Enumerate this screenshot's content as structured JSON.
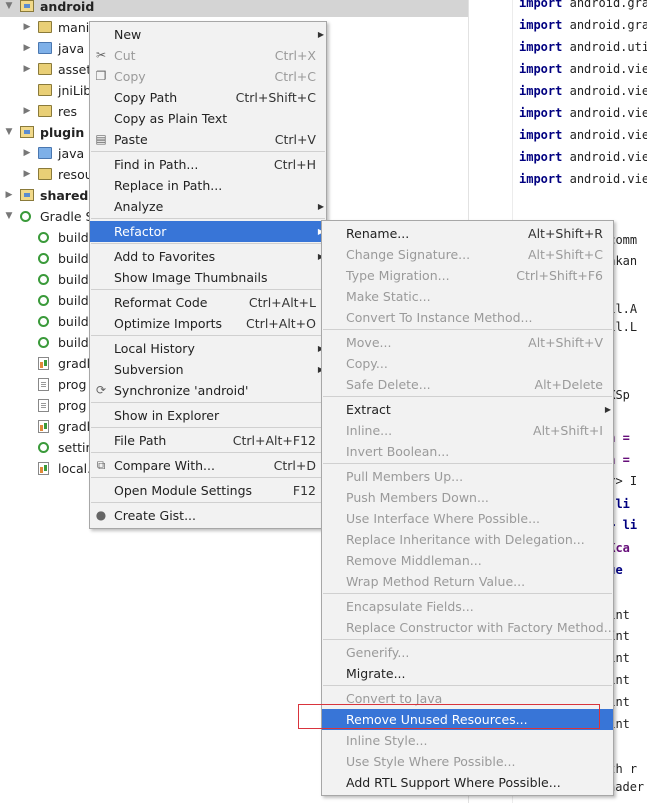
{
  "tree": {
    "items": [
      {
        "label": "android",
        "bold": true,
        "selected": true,
        "expanded": true,
        "depth": 0,
        "icon": "module-folder-icon"
      },
      {
        "label": "manit",
        "depth": 1,
        "icon": "folder-icon"
      },
      {
        "label": "java",
        "depth": 1,
        "icon": "source-folder-icon"
      },
      {
        "label": "asset",
        "depth": 1,
        "icon": "assets-folder-icon"
      },
      {
        "label": "jniLib",
        "depth": 1,
        "icon": "folder-icon",
        "noarrow": true
      },
      {
        "label": "res",
        "depth": 1,
        "icon": "resources-folder-icon"
      },
      {
        "label": "plugin",
        "bold": true,
        "expanded": true,
        "depth": 0,
        "icon": "module-folder-icon"
      },
      {
        "label": "java",
        "depth": 1,
        "icon": "source-folder-icon"
      },
      {
        "label": "resou",
        "depth": 1,
        "icon": "resources-folder-icon"
      },
      {
        "label": "shared",
        "bold": true,
        "depth": 0,
        "icon": "module-folder-icon"
      },
      {
        "label": "Gradle S",
        "expanded": true,
        "depth": 0,
        "icon": "gradle-icon"
      },
      {
        "label": "build",
        "depth": 1,
        "icon": "gradle-icon",
        "noarrow": true
      },
      {
        "label": "build",
        "depth": 1,
        "icon": "gradle-icon",
        "noarrow": true
      },
      {
        "label": "build",
        "depth": 1,
        "icon": "gradle-icon",
        "noarrow": true
      },
      {
        "label": "build",
        "depth": 1,
        "icon": "gradle-icon",
        "noarrow": true
      },
      {
        "label": "build",
        "depth": 1,
        "icon": "gradle-icon",
        "noarrow": true
      },
      {
        "label": "build",
        "depth": 1,
        "icon": "gradle-icon",
        "noarrow": true
      },
      {
        "label": "gradl",
        "depth": 1,
        "icon": "gradle-file-icon",
        "noarrow": true
      },
      {
        "label": "prog",
        "depth": 1,
        "icon": "text-file-icon",
        "noarrow": true
      },
      {
        "label": "prog",
        "depth": 1,
        "icon": "text-file-icon",
        "noarrow": true
      },
      {
        "label": "gradl",
        "depth": 1,
        "icon": "gradle-file-icon",
        "noarrow": true
      },
      {
        "label": "settin",
        "depth": 1,
        "icon": "gradle-icon",
        "noarrow": true
      },
      {
        "label": "local.",
        "depth": 1,
        "icon": "gradle-file-icon",
        "noarrow": true
      }
    ]
  },
  "editor": {
    "import_lines": [
      {
        "kw": "import",
        "text": "android.gra"
      },
      {
        "kw": "import",
        "text": "android.gra"
      },
      {
        "kw": "import",
        "text": "android.uti"
      },
      {
        "kw": "import",
        "text": "android.vie"
      },
      {
        "kw": "import",
        "text": "android.vie"
      },
      {
        "kw": "import",
        "text": "android.vie"
      },
      {
        "kw": "import",
        "text": "android.vie"
      },
      {
        "kw": "import",
        "text": "android.vie"
      },
      {
        "kw": "import",
        "text": "android.vie"
      }
    ],
    "fragments": [
      {
        "text": ".comm",
        "style": "plain"
      },
      {
        "text": "inkan",
        "style": "plain"
      },
      {
        "text": "til.A",
        "style": "plain"
      },
      {
        "text": "til.L",
        "style": "plain"
      },
      {
        "text": "WXSp",
        "style": "plain"
      },
      {
        "text": "gh =",
        "style": "p"
      },
      {
        "text": "th =",
        "style": "p"
      },
      {
        "text": "er> I",
        "style": "plain"
      },
      {
        "text": "> li",
        "style": "b"
      },
      {
        "text": "g> li",
        "style": "b"
      },
      {
        "text": "sKca",
        "style": "p"
      },
      {
        "text": "lue",
        "style": "b"
      },
      {
        "text": "aint",
        "style": "plain"
      },
      {
        "text": "aint",
        "style": "plain"
      },
      {
        "text": "aint",
        "style": "plain"
      },
      {
        "text": "aint",
        "style": "plain"
      },
      {
        "text": "aint",
        "style": "plain"
      },
      {
        "text": "aint",
        "style": "plain"
      },
      {
        "text": "ath r",
        "style": "plain"
      },
      {
        "text": "Shader mShader",
        "style": "plain"
      }
    ]
  },
  "context_menu": {
    "items": [
      {
        "label": "New",
        "submenu": true
      },
      {
        "label": "Cut",
        "shortcut": "Ctrl+X",
        "disabled": true,
        "icon": "scissors-icon"
      },
      {
        "label": "Copy",
        "shortcut": "Ctrl+C",
        "disabled": true,
        "icon": "copy-icon"
      },
      {
        "label": "Copy Path",
        "shortcut": "Ctrl+Shift+C"
      },
      {
        "label": "Copy as Plain Text"
      },
      {
        "label": "Paste",
        "shortcut": "Ctrl+V",
        "icon": "paste-icon"
      },
      {
        "sep": true
      },
      {
        "label": "Find in Path...",
        "shortcut": "Ctrl+H"
      },
      {
        "label": "Replace in Path..."
      },
      {
        "label": "Analyze",
        "submenu": true
      },
      {
        "sep": true
      },
      {
        "label": "Refactor",
        "submenu": true,
        "highlighted": true
      },
      {
        "sep": true
      },
      {
        "label": "Add to Favorites",
        "submenu": true
      },
      {
        "label": "Show Image Thumbnails"
      },
      {
        "sep": true
      },
      {
        "label": "Reformat Code",
        "shortcut": "Ctrl+Alt+L"
      },
      {
        "label": "Optimize Imports",
        "shortcut": "Ctrl+Alt+O"
      },
      {
        "sep": true
      },
      {
        "label": "Local History",
        "submenu": true
      },
      {
        "label": "Subversion",
        "submenu": true
      },
      {
        "label": "Synchronize 'android'",
        "icon": "sync-icon"
      },
      {
        "sep": true
      },
      {
        "label": "Show in Explorer"
      },
      {
        "sep": true
      },
      {
        "label": "File Path",
        "shortcut": "Ctrl+Alt+F12"
      },
      {
        "sep": true
      },
      {
        "label": "Compare With...",
        "shortcut": "Ctrl+D",
        "icon": "compare-icon"
      },
      {
        "sep": true
      },
      {
        "label": "Open Module Settings",
        "shortcut": "F12"
      },
      {
        "sep": true
      },
      {
        "label": "Create Gist...",
        "icon": "github-icon"
      }
    ]
  },
  "refactor_menu": {
    "items": [
      {
        "label": "Rename...",
        "shortcut": "Alt+Shift+R"
      },
      {
        "label": "Change Signature...",
        "shortcut": "Alt+Shift+C",
        "disabled": true
      },
      {
        "label": "Type Migration...",
        "shortcut": "Ctrl+Shift+F6",
        "disabled": true
      },
      {
        "label": "Make Static...",
        "disabled": true
      },
      {
        "label": "Convert To Instance Method...",
        "disabled": true
      },
      {
        "sep": true
      },
      {
        "label": "Move...",
        "shortcut": "Alt+Shift+V",
        "disabled": true
      },
      {
        "label": "Copy...",
        "disabled": true
      },
      {
        "label": "Safe Delete...",
        "shortcut": "Alt+Delete",
        "disabled": true
      },
      {
        "sep": true
      },
      {
        "label": "Extract",
        "submenu": true
      },
      {
        "label": "Inline...",
        "shortcut": "Alt+Shift+I",
        "disabled": true
      },
      {
        "label": "Invert Boolean...",
        "disabled": true
      },
      {
        "sep": true
      },
      {
        "label": "Pull Members Up...",
        "disabled": true
      },
      {
        "label": "Push Members Down...",
        "disabled": true
      },
      {
        "label": "Use Interface Where Possible...",
        "disabled": true
      },
      {
        "label": "Replace Inheritance with Delegation...",
        "disabled": true
      },
      {
        "label": "Remove Middleman...",
        "disabled": true
      },
      {
        "label": "Wrap Method Return Value...",
        "disabled": true
      },
      {
        "sep": true
      },
      {
        "label": "Encapsulate Fields...",
        "disabled": true
      },
      {
        "label": "Replace Constructor with Factory Method...",
        "disabled": true
      },
      {
        "sep": true
      },
      {
        "label": "Generify...",
        "disabled": true
      },
      {
        "label": "Migrate..."
      },
      {
        "sep": true
      },
      {
        "label": "Convert to Java",
        "disabled": true
      },
      {
        "label": "Remove Unused Resources...",
        "highlighted": true
      },
      {
        "label": "Inline Style...",
        "disabled": true
      },
      {
        "label": "Use Style Where Possible...",
        "disabled": true
      },
      {
        "label": "Add RTL Support Where Possible..."
      }
    ]
  }
}
